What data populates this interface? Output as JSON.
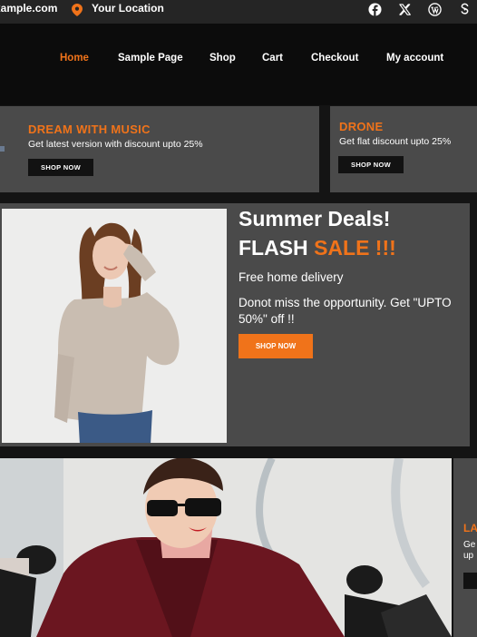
{
  "topbar": {
    "email": "xample.com",
    "location": "Your Location",
    "social": [
      {
        "icon": "facebook-icon"
      },
      {
        "icon": "x-twitter-icon"
      },
      {
        "icon": "wordpress-icon"
      },
      {
        "icon": "share-icon"
      }
    ]
  },
  "nav": {
    "items": [
      "Home",
      "Sample Page",
      "Shop",
      "Cart",
      "Checkout",
      "My account"
    ],
    "active": "Home"
  },
  "promos": [
    {
      "title": "DREAM WITH MUSIC",
      "subtitle": "Get latest version with discount upto 25%",
      "button": "SHOP NOW"
    },
    {
      "title": "DRONE",
      "subtitle": "Get flat discount upto 25%",
      "button": "SHOP NOW"
    }
  ],
  "flash": {
    "heading": "Summer Deals!",
    "heading2_white": "FLASH ",
    "heading2_orange": "SALE !!!",
    "line1": "Free home delivery",
    "line2": "Donot miss the opportunity. Get \"UPTO 50%\" off !!",
    "button": "SHOP NOW"
  },
  "bottom": {
    "side_title": "LA",
    "side_sub1": "Ge",
    "side_sub2": "up"
  },
  "colors": {
    "accent": "#f0731a",
    "panel": "#4a4a4a",
    "nav_bg": "#0c0c0c",
    "page_bg": "#141414"
  }
}
